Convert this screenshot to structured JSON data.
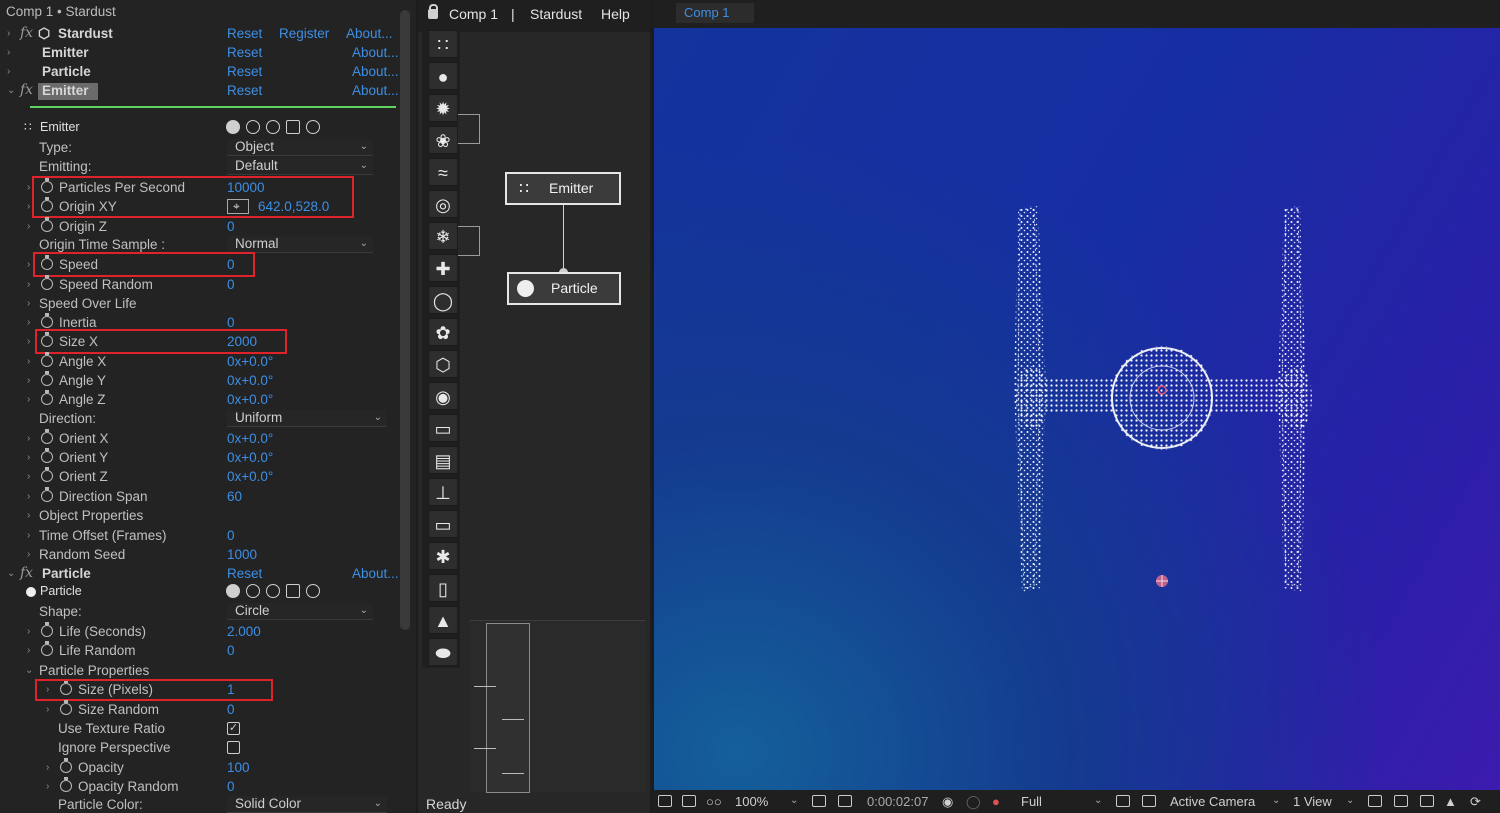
{
  "fx_panel": {
    "title": "Comp 1 • Stardust",
    "top_rows": [
      {
        "name": "Stardust",
        "reset": "Reset",
        "register": "Register",
        "about": "About..."
      },
      {
        "name": "Emitter",
        "reset": "Reset",
        "about": "About..."
      },
      {
        "name": "Particle",
        "reset": "Reset",
        "about": "About..."
      },
      {
        "name": "Emitter",
        "reset": "Reset",
        "about": "About..."
      }
    ],
    "emitter": {
      "label": "Emitter",
      "type_label": "Type:",
      "type_value": "Object",
      "emitting_label": "Emitting:",
      "emitting_value": "Default",
      "pps_label": "Particles Per Second",
      "pps_value": "10000",
      "origin_xy_label": "Origin XY",
      "origin_xy_value": "642.0,528.0",
      "origin_z_label": "Origin Z",
      "origin_z_value": "0",
      "ots_label": "Origin Time Sample :",
      "ots_value": "Normal",
      "speed_label": "Speed",
      "speed_value": "0",
      "speed_random_label": "Speed Random",
      "speed_random_value": "0",
      "speed_over_life_label": "Speed Over Life",
      "inertia_label": "Inertia",
      "inertia_value": "0",
      "size_x_label": "Size X",
      "size_x_value": "2000",
      "angle_x_label": "Angle X",
      "angle_x_value": "0x+0.0°",
      "angle_y_label": "Angle Y",
      "angle_y_value": "0x+0.0°",
      "angle_z_label": "Angle Z",
      "angle_z_value": "0x+0.0°",
      "direction_label": "Direction:",
      "direction_value": "Uniform",
      "orient_x_label": "Orient X",
      "orient_x_value": "0x+0.0°",
      "orient_y_label": "Orient Y",
      "orient_y_value": "0x+0.0°",
      "orient_z_label": "Orient Z",
      "orient_z_value": "0x+0.0°",
      "direction_span_label": "Direction Span",
      "direction_span_value": "60",
      "object_props_label": "Object Properties",
      "time_offset_label": "Time Offset (Frames)",
      "time_offset_value": "0",
      "random_seed_label": "Random Seed",
      "random_seed_value": "1000"
    },
    "particle": {
      "header": "Particle",
      "reset": "Reset",
      "about": "About...",
      "label": "Particle",
      "shape_label": "Shape:",
      "shape_value": "Circle",
      "life_label": "Life (Seconds)",
      "life_value": "2.000",
      "life_random_label": "Life Random",
      "life_random_value": "0",
      "props_label": "Particle Properties",
      "size_px_label": "Size (Pixels)",
      "size_px_value": "1",
      "size_random_label": "Size Random",
      "size_random_value": "0",
      "use_texture_label": "Use Texture Ratio",
      "ignore_persp_label": "Ignore Perspective",
      "opacity_label": "Opacity",
      "opacity_value": "100",
      "opacity_random_label": "Opacity Random",
      "opacity_random_value": "0",
      "color_label": "Particle Color:",
      "color_value": "Solid Color"
    }
  },
  "middle": {
    "tabs": [
      "Comp 1",
      "|",
      "Stardust",
      "Help"
    ],
    "node_emitter": "Emitter",
    "node_particle": "Particle",
    "status": "Ready"
  },
  "viewer": {
    "tab": "Comp 1",
    "zoom": "100%",
    "timecode": "0:00:02:07",
    "resolution": "Full",
    "camera": "Active Camera",
    "views": "1 View"
  },
  "colors": {
    "accent_blue": "#3d8fe6",
    "highlight_red": "#e0232b",
    "separator_green": "#5fd35f"
  }
}
